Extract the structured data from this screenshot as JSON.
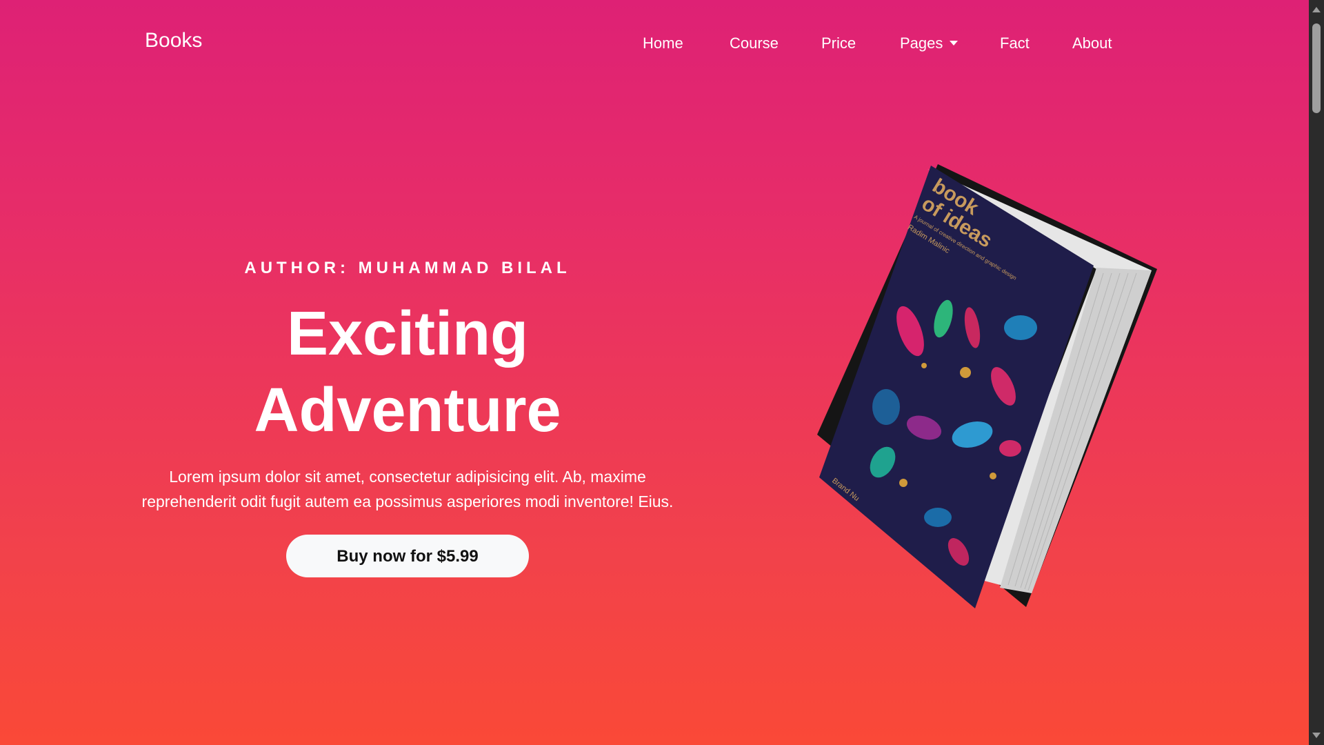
{
  "nav": {
    "brand": "Books",
    "items": [
      {
        "label": "Home"
      },
      {
        "label": "Course"
      },
      {
        "label": "Price"
      },
      {
        "label": "Pages"
      },
      {
        "label": "Fact"
      },
      {
        "label": "About"
      }
    ]
  },
  "hero": {
    "author": "AUTHOR: MUHAMMAD BILAL",
    "title_line1": "Exciting",
    "title_line2": "Adventure",
    "description_line1": "Lorem ipsum dolor sit amet, consectetur adipisicing elit. Ab, maxime",
    "description_line2": "reprehenderit odit fugit autem ea possimus asperiores modi inventore! Eius.",
    "cta_label": "Buy now for $5.99"
  },
  "book": {
    "cover_title_line1": "book",
    "cover_title_line2": "of ideas",
    "cover_subtitle": "A journal of creative direction and graphic design",
    "cover_author": "Radim Malinic",
    "cover_publisher": "Brand Nu"
  },
  "colors": {
    "gradient_top": "#de2175",
    "gradient_bottom": "#fa4937",
    "button_bg": "#f8f9fa",
    "cover_bg": "#1f1d4a"
  }
}
